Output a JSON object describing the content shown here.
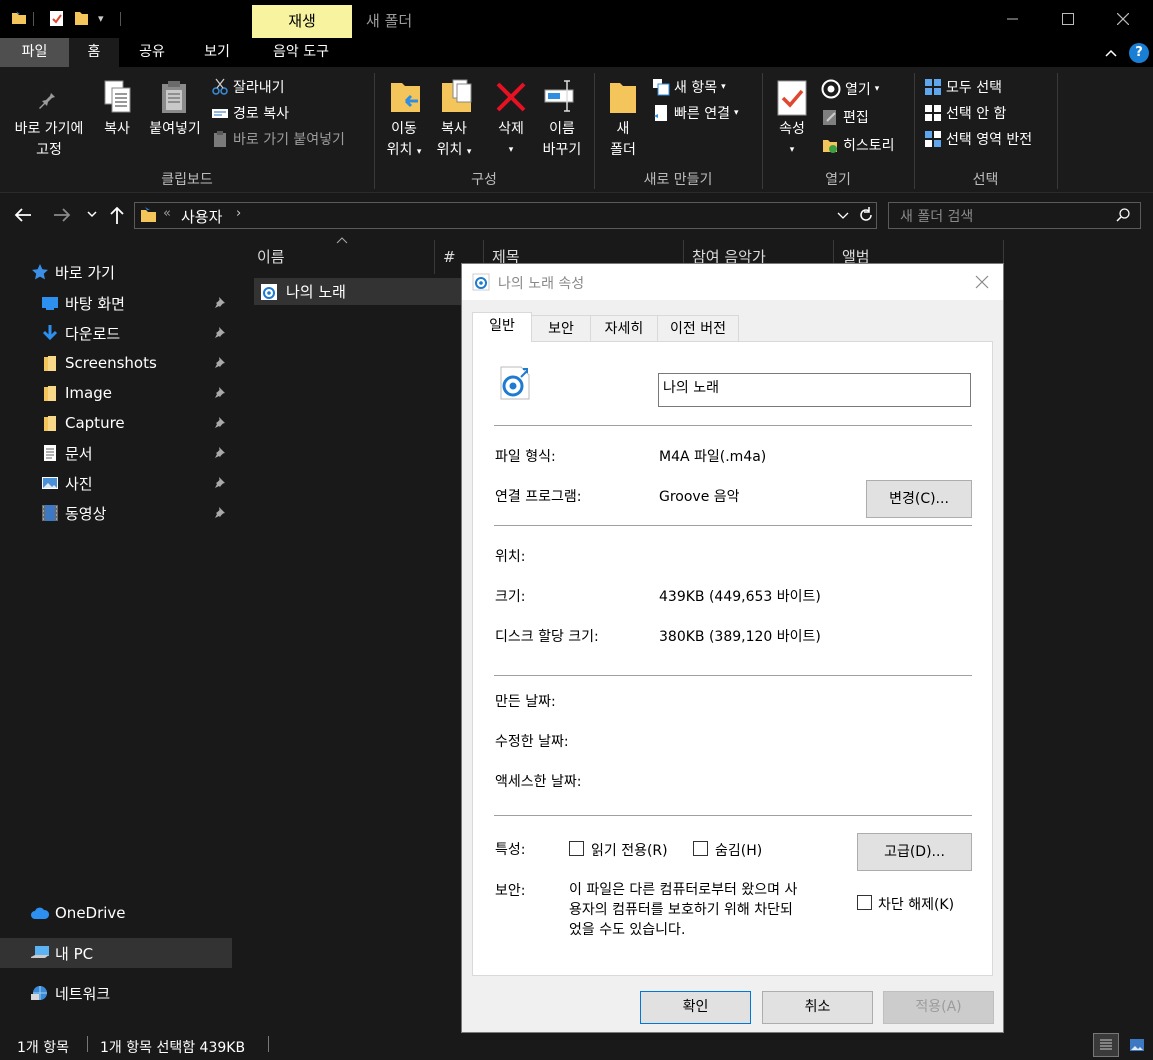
{
  "window": {
    "title": "새 폴더",
    "contextual_tab": "재생"
  },
  "ribbon_tabs": [
    "파일",
    "홈",
    "공유",
    "보기",
    "음악 도구"
  ],
  "ribbon": {
    "clipboard": {
      "pin_label_1": "바로 가기에",
      "pin_label_2": "고정",
      "copy": "복사",
      "paste": "붙여넣기",
      "cut": "잘라내기",
      "copy_path": "경로 복사",
      "paste_shortcut": "바로 가기 붙여넣기",
      "group": "클립보드"
    },
    "organize": {
      "move_1": "이동",
      "move_2": "위치",
      "copyto_1": "복사",
      "copyto_2": "위치",
      "delete": "삭제",
      "rename_1": "이름",
      "rename_2": "바꾸기",
      "group": "구성"
    },
    "new": {
      "folder_1": "새",
      "folder_2": "폴더",
      "new_item": "새 항목",
      "easy_access": "빠른 연결",
      "group": "새로 만들기"
    },
    "open": {
      "properties": "속성",
      "open": "열기",
      "edit": "편집",
      "history": "히스토리",
      "group": "열기"
    },
    "select": {
      "select_all": "모두 선택",
      "select_none": "선택 안 함",
      "invert": "선택 영역 반전",
      "group": "선택"
    }
  },
  "address": {
    "path_prefix": "«",
    "path": "사용자",
    "search_placeholder": "새 폴더 검색"
  },
  "nav": {
    "quick_access": "바로 가기",
    "items": [
      "바탕 화면",
      "다운로드",
      "Screenshots",
      "Image",
      "Capture",
      "문서",
      "사진",
      "동영상"
    ],
    "onedrive": "OneDrive",
    "this_pc": "내 PC",
    "network": "네트워크"
  },
  "columns": [
    "이름",
    "#",
    "제목",
    "참여 음악가",
    "앨범"
  ],
  "files": [
    {
      "name": "나의 노래"
    }
  ],
  "status": {
    "count": "1개 항목",
    "selected": "1개 항목 선택함 439KB"
  },
  "dialog": {
    "title": "나의 노래 속성",
    "tabs": [
      "일반",
      "보안",
      "자세히",
      "이전 버전"
    ],
    "filename": "나의 노래",
    "file_type_label": "파일 형식:",
    "file_type": "M4A 파일(.m4a)",
    "opens_with_label": "연결 프로그램:",
    "opens_with": "Groove 음악",
    "change_button": "변경(C)...",
    "location_label": "위치:",
    "size_label": "크기:",
    "size": "439KB (449,653 바이트)",
    "size_on_disk_label": "디스크 할당 크기:",
    "size_on_disk": "380KB (389,120 바이트)",
    "created_label": "만든 날짜:",
    "modified_label": "수정한 날짜:",
    "accessed_label": "액세스한 날짜:",
    "attributes_label": "특성:",
    "readonly": "읽기 전용(R)",
    "hidden": "숨김(H)",
    "advanced_button": "고급(D)...",
    "security_label": "보안:",
    "security_line1": "이 파일은 다른 컴퓨터로부터 왔으며 사",
    "security_line2": "용자의 컴퓨터를 보호하기 위해 차단되",
    "security_line3": "었을 수도 있습니다.",
    "unblock": "차단 해제(K)",
    "ok": "확인",
    "cancel": "취소",
    "apply": "적용(A)"
  },
  "colors": {
    "accent_yellow": "#f7f39f",
    "folder": "#f4c55a",
    "delete_red": "#e81123",
    "link_blue": "#0a6cc4"
  }
}
